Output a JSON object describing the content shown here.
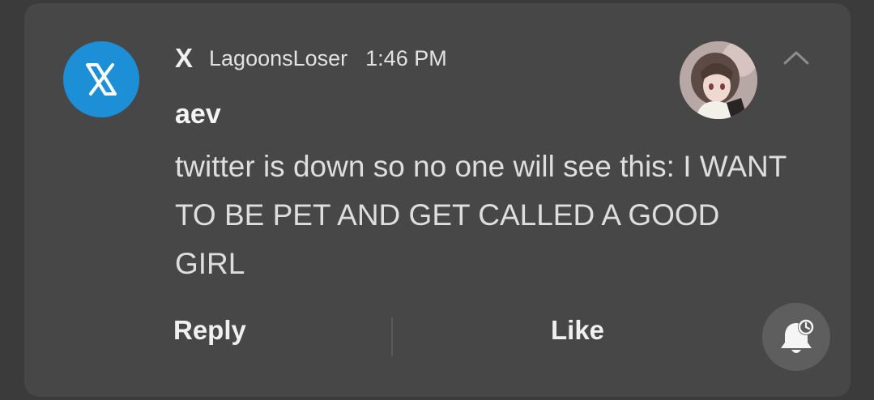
{
  "notification": {
    "app_name": "X",
    "account": "LagoonsLoser",
    "time": "1:46 PM",
    "sender": "aev",
    "message": "twitter is down so no one will see this: I WANT TO BE PET AND GET CALLED A GOOD GIRL"
  },
  "actions": {
    "reply_label": "Reply",
    "like_label": "Like"
  },
  "icons": {
    "app_icon": "x-logo-icon",
    "avatar": "user-avatar",
    "collapse": "chevron-up-icon",
    "snooze": "bell-snooze-icon"
  },
  "colors": {
    "background": "#3b3b3b",
    "card": "#474747",
    "app_icon_bg": "#1d8fd6",
    "text_primary": "#f0f0f0",
    "text_secondary": "#dedede",
    "bell_button_bg": "#5e5e5e"
  }
}
